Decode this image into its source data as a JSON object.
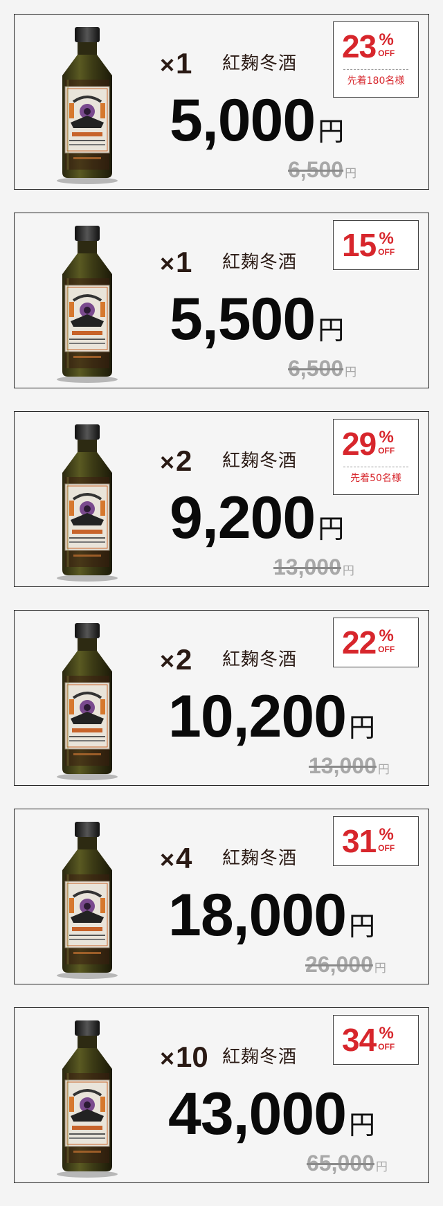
{
  "offers": [
    {
      "qty_prefix": "×",
      "qty": "1",
      "product": "紅麹冬酒",
      "price": "5,000",
      "yen": "円",
      "old_price": "6,500",
      "old_yen": "円",
      "discount": "23",
      "percent": "%",
      "off": "OFF",
      "limit": "先着180名様"
    },
    {
      "qty_prefix": "×",
      "qty": "1",
      "product": "紅麹冬酒",
      "price": "5,500",
      "yen": "円",
      "old_price": "6,500",
      "old_yen": "円",
      "discount": "15",
      "percent": "%",
      "off": "OFF",
      "limit": ""
    },
    {
      "qty_prefix": "×",
      "qty": "2",
      "product": "紅麹冬酒",
      "price": "9,200",
      "yen": "円",
      "old_price": "13,000",
      "old_yen": "円",
      "discount": "29",
      "percent": "%",
      "off": "OFF",
      "limit": "先着50名様"
    },
    {
      "qty_prefix": "×",
      "qty": "2",
      "product": "紅麹冬酒",
      "price": "10,200",
      "yen": "円",
      "old_price": "13,000",
      "old_yen": "円",
      "discount": "22",
      "percent": "%",
      "off": "OFF",
      "limit": ""
    },
    {
      "qty_prefix": "×",
      "qty": "4",
      "product": "紅麹冬酒",
      "price": "18,000",
      "yen": "円",
      "old_price": "26,000",
      "old_yen": "円",
      "discount": "31",
      "percent": "%",
      "off": "OFF",
      "limit": ""
    },
    {
      "qty_prefix": "×",
      "qty": "10",
      "product": "紅麹冬酒",
      "price": "43,000",
      "yen": "円",
      "old_price": "65,000",
      "old_yen": "円",
      "discount": "34",
      "percent": "%",
      "off": "OFF",
      "limit": ""
    }
  ],
  "bottle_label_text": "RED PEPPED KOJI WINTER",
  "colors": {
    "accent_red": "#d7262c",
    "bottle_glass": "#4a4a1c",
    "liquid": "#3b1d10",
    "price_text": "#0a0a0a",
    "old_price_text": "#a8a8a8"
  },
  "icons": {
    "product_image": "koji-winter-wine-bottle"
  }
}
